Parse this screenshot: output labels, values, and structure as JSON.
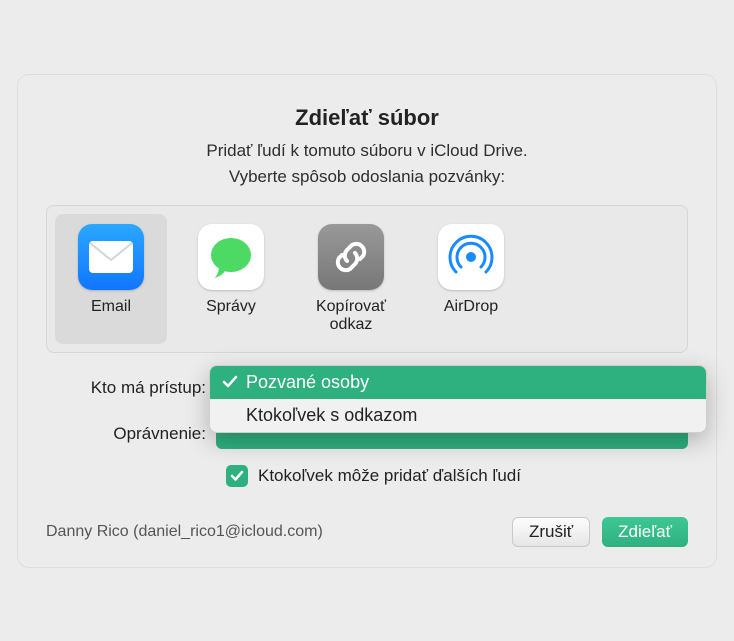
{
  "title": "Zdieľať súbor",
  "subtitle1": "Pridať ľudí k tomuto súboru v iCloud Drive.",
  "subtitle2": "Vyberte spôsob odoslania pozvánky:",
  "methods": {
    "email": "Email",
    "messages": "Správy",
    "copylink": "Kopírovať odkaz",
    "airdrop": "AirDrop"
  },
  "labels": {
    "access": "Kto má prístup:",
    "permission": "Oprávnenie:"
  },
  "access_options": {
    "invited": "Pozvané osoby",
    "anyone_link": "Ktokoľvek s odkazom"
  },
  "checkbox_label": "Ktokoľvek môže pridať ďalších ľudí",
  "user": "Danny Rico (daniel_rico1@icloud.com)",
  "buttons": {
    "cancel": "Zrušiť",
    "share": "Zdieľať"
  }
}
